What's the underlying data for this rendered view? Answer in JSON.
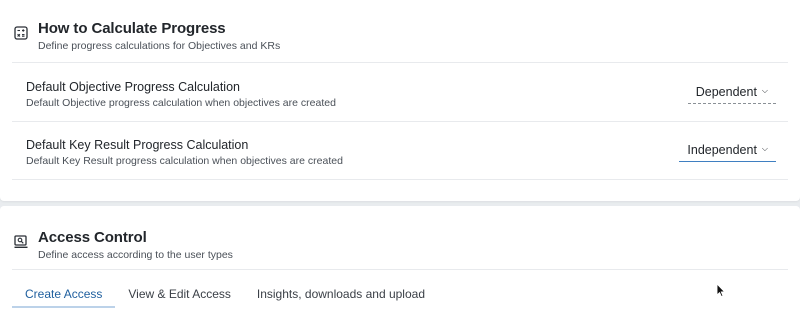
{
  "progress_section": {
    "icon": "calculator-icon",
    "title": "How to Calculate Progress",
    "subtitle": "Define progress calculations for Objectives and KRs",
    "rows": [
      {
        "title": "Default Objective Progress Calculation",
        "description": "Default Objective progress calculation when objectives are created",
        "selected": "Dependent"
      },
      {
        "title": "Default Key Result Progress Calculation",
        "description": "Default Key Result progress calculation when objectives are created",
        "selected": "Independent"
      }
    ]
  },
  "access_section": {
    "icon": "access-control-icon",
    "title": "Access Control",
    "subtitle": "Define access according to the user types",
    "tabs": [
      {
        "label": "Create Access",
        "active": true
      },
      {
        "label": "View & Edit Access",
        "active": false
      },
      {
        "label": "Insights, downloads and upload",
        "active": false
      }
    ]
  },
  "colors": {
    "accent": "#3f7fc1",
    "page_background": "#e9ecef",
    "card_background": "#ffffff"
  }
}
